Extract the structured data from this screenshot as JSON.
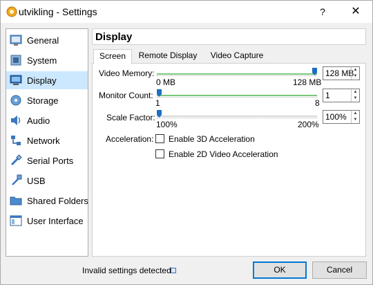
{
  "window": {
    "title": "utvikling - Settings",
    "help_glyph": "?",
    "close_glyph": "✕"
  },
  "sidebar": {
    "items": [
      {
        "label": "General",
        "icon": "general-icon",
        "selected": false
      },
      {
        "label": "System",
        "icon": "system-icon",
        "selected": false
      },
      {
        "label": "Display",
        "icon": "display-icon",
        "selected": true
      },
      {
        "label": "Storage",
        "icon": "storage-icon",
        "selected": false
      },
      {
        "label": "Audio",
        "icon": "audio-icon",
        "selected": false
      },
      {
        "label": "Network",
        "icon": "network-icon",
        "selected": false
      },
      {
        "label": "Serial Ports",
        "icon": "serial-ports-icon",
        "selected": false
      },
      {
        "label": "USB",
        "icon": "usb-icon",
        "selected": false
      },
      {
        "label": "Shared Folders",
        "icon": "shared-folders-icon",
        "selected": false
      },
      {
        "label": "User Interface",
        "icon": "user-interface-icon",
        "selected": false
      }
    ]
  },
  "main": {
    "section_title": "Display",
    "tabs": [
      {
        "label": "Screen",
        "active": true
      },
      {
        "label": "Remote Display",
        "active": false
      },
      {
        "label": "Video Capture",
        "active": false
      }
    ]
  },
  "screen": {
    "video_memory": {
      "label": "Video Memory:",
      "min_label": "0 MB",
      "max_label": "128 MB",
      "value": "128 MB",
      "level": 1.0
    },
    "monitor_count": {
      "label": "Monitor Count:",
      "min_label": "1",
      "max_label": "8",
      "value": "1",
      "level": 0.0
    },
    "scale_factor": {
      "label": "Scale Factor:",
      "min_label": "100%",
      "max_label": "200%",
      "value": "100%",
      "level": 0.0
    },
    "acceleration": {
      "label": "Acceleration:",
      "options": [
        {
          "label": "Enable 3D Acceleration",
          "checked": false
        },
        {
          "label": "Enable 2D Video Acceleration",
          "checked": false
        }
      ]
    }
  },
  "footer": {
    "status_text": "Invalid settings detected",
    "ok_label": "OK",
    "cancel_label": "Cancel"
  },
  "colors": {
    "accent": "#0078d7",
    "selection": "#cce8ff",
    "slider_ok": "#7ac77a",
    "slider_warn": "#f0c27a",
    "slider_thumb": "#1d6fc0"
  }
}
